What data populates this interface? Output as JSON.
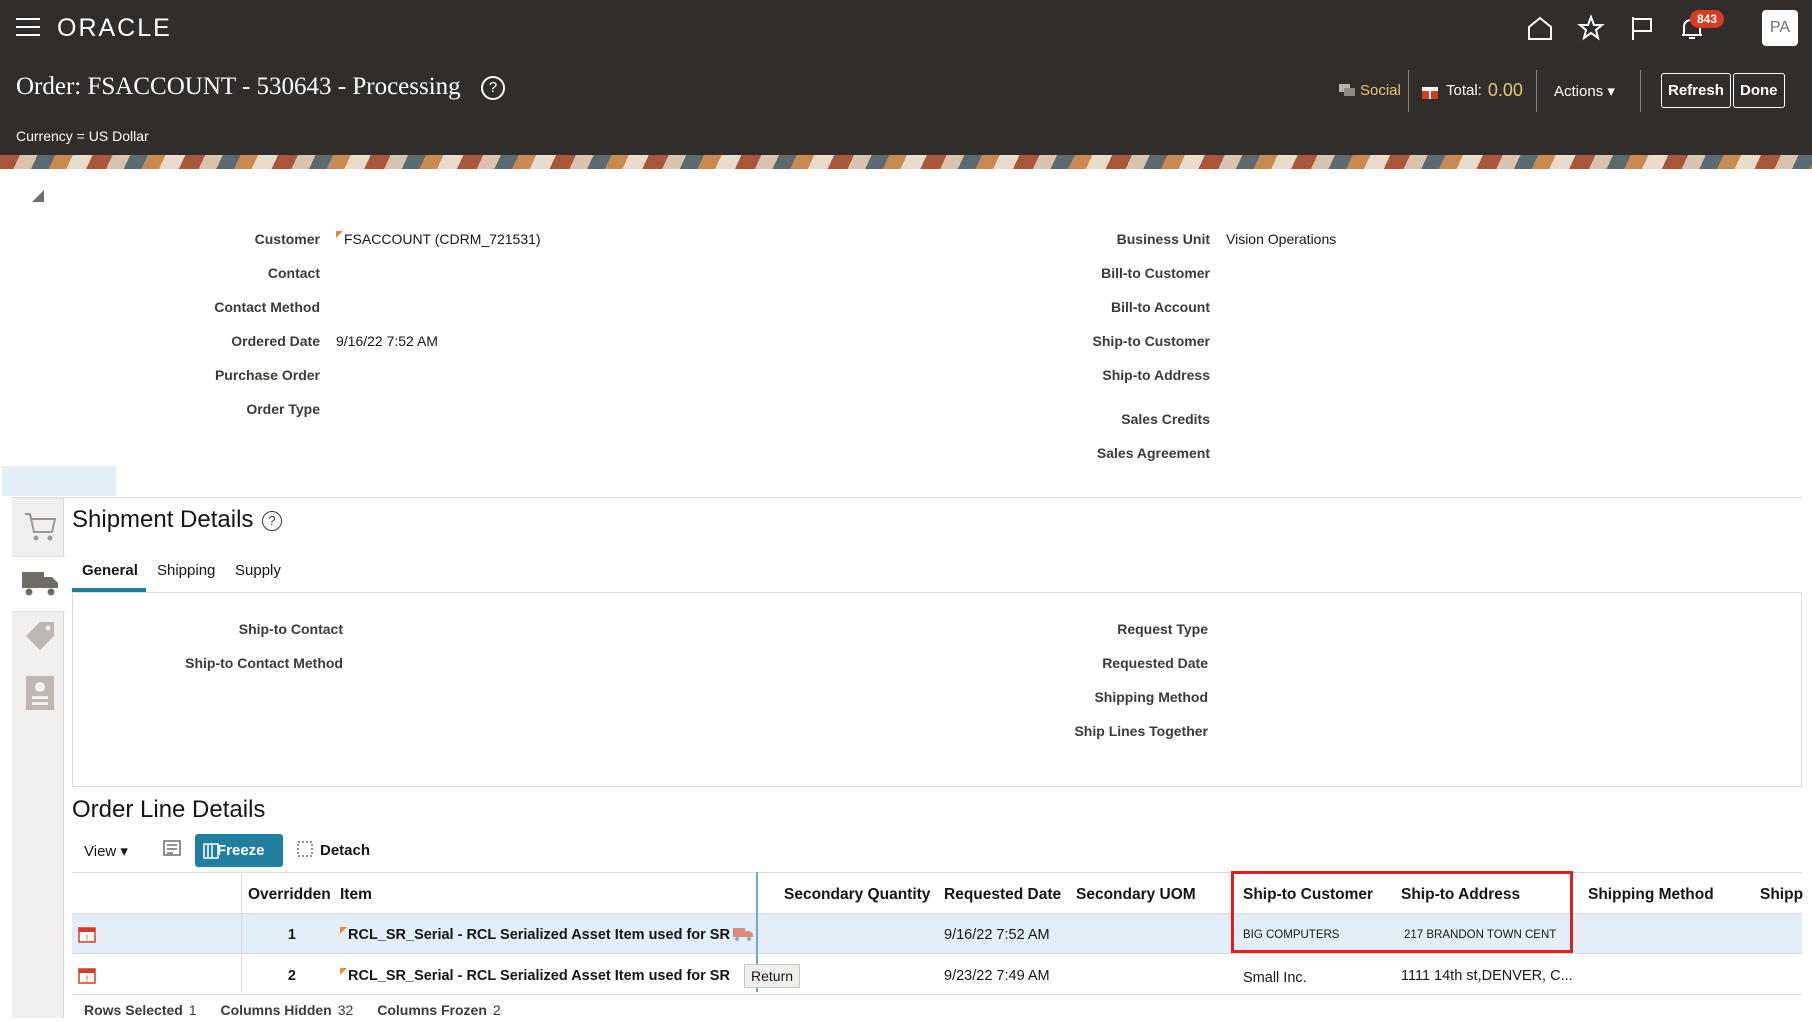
{
  "header": {
    "logo": "ORACLE",
    "notification_count": "843",
    "avatar_initials": "PA",
    "order_title": "Order: FSACCOUNT - 530643 - Processing",
    "currency": "Currency = US Dollar",
    "social_label": "Social",
    "total_label": "Total:",
    "total_value": "0.00",
    "actions_label": "Actions",
    "refresh_label": "Refresh",
    "done_label": "Done"
  },
  "order_header": {
    "left": [
      {
        "label": "Customer",
        "value": "FSACCOUNT (CDRM_721531)"
      },
      {
        "label": "Contact",
        "value": ""
      },
      {
        "label": "Contact Method",
        "value": ""
      },
      {
        "label": "Ordered Date",
        "value": "9/16/22 7:52 AM"
      },
      {
        "label": "Purchase Order",
        "value": ""
      },
      {
        "label": "Order Type",
        "value": ""
      }
    ],
    "right": [
      {
        "label": "Business Unit",
        "value": "Vision Operations"
      },
      {
        "label": "Bill-to Customer",
        "value": ""
      },
      {
        "label": "Bill-to Account",
        "value": ""
      },
      {
        "label": "Ship-to Customer",
        "value": ""
      },
      {
        "label": "Ship-to Address",
        "value": ""
      },
      {
        "label": "Sales Credits",
        "value": ""
      },
      {
        "label": "Sales Agreement",
        "value": ""
      }
    ]
  },
  "shipment": {
    "title": "Shipment Details",
    "tabs": [
      "General",
      "Shipping",
      "Supply"
    ],
    "left_fields": [
      "Ship-to Contact",
      "Ship-to Contact Method"
    ],
    "right_fields": [
      "Request Type",
      "Requested Date",
      "Shipping Method",
      "Ship Lines Together"
    ]
  },
  "order_lines": {
    "title": "Order Line Details",
    "toolbar": {
      "view": "View",
      "freeze": "Freeze",
      "detach": "Detach"
    },
    "columns": [
      "Overridden",
      "Item",
      "Secondary Quantity",
      "Requested Date",
      "Secondary UOM",
      "Ship-to Customer",
      "Ship-to Address",
      "Shipping Method",
      "Shipp"
    ],
    "rows": [
      {
        "num": "1",
        "item": "RCL_SR_Serial - RCL Serialized Asset Item used for SR",
        "requested_date": "9/16/22 7:52 AM",
        "ship_to_customer": "BIG COMPUTERS",
        "ship_to_address": "217 BRANDON TOWN CENT"
      },
      {
        "num": "2",
        "item": "RCL_SR_Serial - RCL Serialized Asset Item used for SR",
        "requested_date": "9/23/22 7:49 AM",
        "ship_to_customer": "Small Inc.",
        "ship_to_address": "1111 14th st,DENVER, C..."
      }
    ],
    "tooltip": "Return",
    "footer": {
      "rows_selected_label": "Rows Selected",
      "rows_selected": "1",
      "columns_hidden_label": "Columns Hidden",
      "columns_hidden": "32",
      "columns_frozen_label": "Columns Frozen",
      "columns_frozen": "2"
    }
  }
}
